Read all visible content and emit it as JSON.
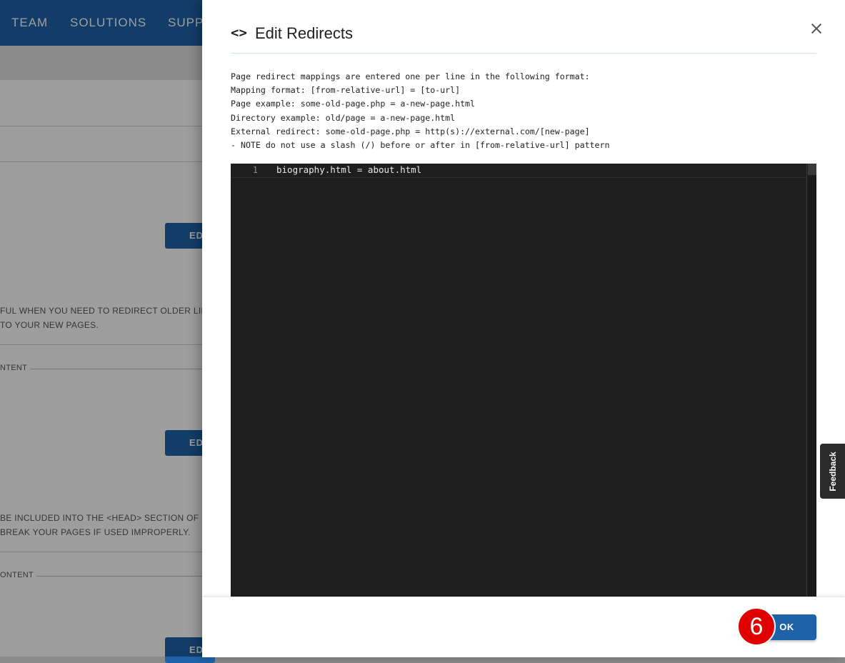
{
  "background": {
    "nav_items": [
      "TEAM",
      "SOLUTIONS",
      "SUPP"
    ],
    "button_label": "ED",
    "redirects_desc_line1": "FUL WHEN YOU NEED TO REDIRECT OLDER LINKS",
    "redirects_desc_line2": "TO YOUR NEW PAGES.",
    "legend_content_1": "NTENT",
    "head_desc_line1": "BE INCLUDED INTO THE <HEAD> SECTION OF EV",
    "head_desc_line2": "BREAK YOUR PAGES IF USED IMPROPERLY.",
    "legend_content_2": "ONTENT"
  },
  "dialog": {
    "icon": "code-icon",
    "title": "Edit Redirects",
    "instructions": [
      "Page redirect mappings are entered one per line in the following format:",
      "Mapping format: [from-relative-url] = [to-url]",
      "Page example: some-old-page.php = a-new-page.html",
      "Directory example: old/page = a-new-page.html",
      "External redirect: some-old-page.php = http(s)://external.com/[new-page]",
      "- NOTE do not use a slash (/) before or after in [from-relative-url] pattern"
    ],
    "editor": {
      "lines": [
        {
          "number": "1",
          "text": "biography.html = about.html"
        }
      ]
    },
    "ok_label": "OK",
    "step_badge": "6"
  },
  "feedback_label": "Feedback",
  "colors": {
    "brand_blue": "#1e63a8",
    "editor_bg": "#1e1e1e",
    "badge_red": "#e00000"
  }
}
